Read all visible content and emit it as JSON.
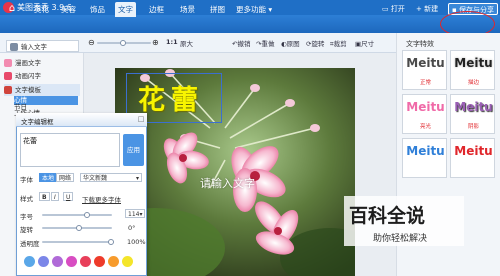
{
  "app": {
    "title": "美图秀秀 3.9.6"
  },
  "window_controls": [
    "-",
    "□",
    "×"
  ],
  "tabs": [
    {
      "label": "美化"
    },
    {
      "label": "美容"
    },
    {
      "label": "饰品"
    },
    {
      "label": "文字"
    },
    {
      "label": "边框"
    },
    {
      "label": "场景"
    },
    {
      "label": "拼图"
    },
    {
      "label": "更多功能 ▾"
    }
  ],
  "top_right": {
    "open": "打开",
    "new": "新建",
    "save_share": "保存与分享"
  },
  "toolbar": {
    "zoom_ratio": "1:1",
    "zoom_label": "原大",
    "tools": [
      "撤销",
      "重做",
      "原图",
      "旋转",
      "裁剪",
      "尺寸"
    ]
  },
  "left_panel": {
    "items": [
      "输入文字",
      "漫画文字",
      "动画闪字",
      "文字模板"
    ],
    "sub_items": [
      "心情",
      "节日",
      "工作心情"
    ]
  },
  "canvas": {
    "text": "花蕾",
    "placeholder": "请输入文字"
  },
  "right_panel": {
    "title": "文字特效",
    "styles": [
      {
        "word": "Meitu",
        "label": "正常",
        "color": "#4a4a4a"
      },
      {
        "word": "Meitu",
        "label": "描边",
        "color": "#222222"
      },
      {
        "word": "Meitu",
        "label": "亮光",
        "color": "#f06aa8"
      },
      {
        "word": "Meitu",
        "label": "阴影",
        "color": "#9a5fb5"
      },
      {
        "word": "Meitu",
        "label": "",
        "color": "#2f7fd8"
      },
      {
        "word": "Meitu",
        "label": "",
        "color": "#e0262b"
      }
    ]
  },
  "dialog": {
    "title": "文字编辑框",
    "text_value": "花蕾",
    "apply": "应用",
    "font_label": "字体",
    "font_tabs": [
      "本地",
      "网络"
    ],
    "font_name": "华文新魏",
    "style_label": "样式",
    "style_buttons": [
      "B",
      "I",
      "U"
    ],
    "download_link": "下载更多字体",
    "size_label": "字号",
    "size_value": "114",
    "rotate_label": "旋转",
    "rotate_value": "0°",
    "opacity_label": "透明度",
    "opacity_value": "100%",
    "swatch_colors": [
      "#5aa7e8",
      "#7b86e8",
      "#b06ad8",
      "#d84dc2",
      "#e83f5a",
      "#ee3b2b",
      "#f79b2c",
      "#f4e52a"
    ]
  },
  "watermark": {
    "text": "百科全说",
    "sub": "助你轻松解决"
  }
}
